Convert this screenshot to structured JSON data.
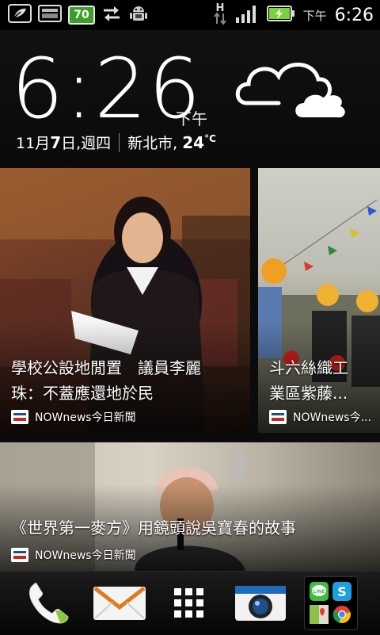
{
  "status_bar": {
    "battery_level": "70",
    "network_type": "H",
    "ampm": "下午",
    "time": "6:26",
    "icons": [
      "evernote-icon",
      "keyboard-icon",
      "battery-level-icon",
      "sync-icon",
      "android-debug-icon",
      "hspa-icon",
      "signal-icon",
      "charging-battery-icon"
    ]
  },
  "clock_widget": {
    "time": "6:26",
    "ampm": "下午",
    "month_day_prefix": "11月",
    "day": "7",
    "day_suffix": "日,",
    "weekday": "週四",
    "city": "新北市,",
    "temperature": "24",
    "temperature_unit": "°C",
    "weather_icon": "cloudy-icon"
  },
  "news": {
    "cards": [
      {
        "headline_line1": "學校公設地閒置　議員李麗",
        "headline_line2": "珠：不蓋應還地於民",
        "source": "NOWnews今日新聞"
      },
      {
        "headline_line1": "斗六絲織工",
        "headline_line2": "業區紫藤...",
        "source": "NOWnews今..."
      },
      {
        "headline_line1": "《世界第一麥方》用鏡頭說吳寶春的故事",
        "source": "NOWnews今日新聞"
      }
    ]
  },
  "dock": {
    "items": [
      "phone-icon",
      "mail-icon",
      "app-drawer-icon",
      "camera-icon"
    ],
    "folder_apps": [
      "line-icon",
      "skype-icon",
      "maps-icon",
      "chrome-icon"
    ],
    "folder_app_labels": {
      "line": "LINE"
    }
  },
  "colors": {
    "battery_green": "#3c9d2c",
    "charging_green": "#7bd23a",
    "phone_green": "#8cc63f",
    "camera_blue": "#1e6bb8"
  }
}
